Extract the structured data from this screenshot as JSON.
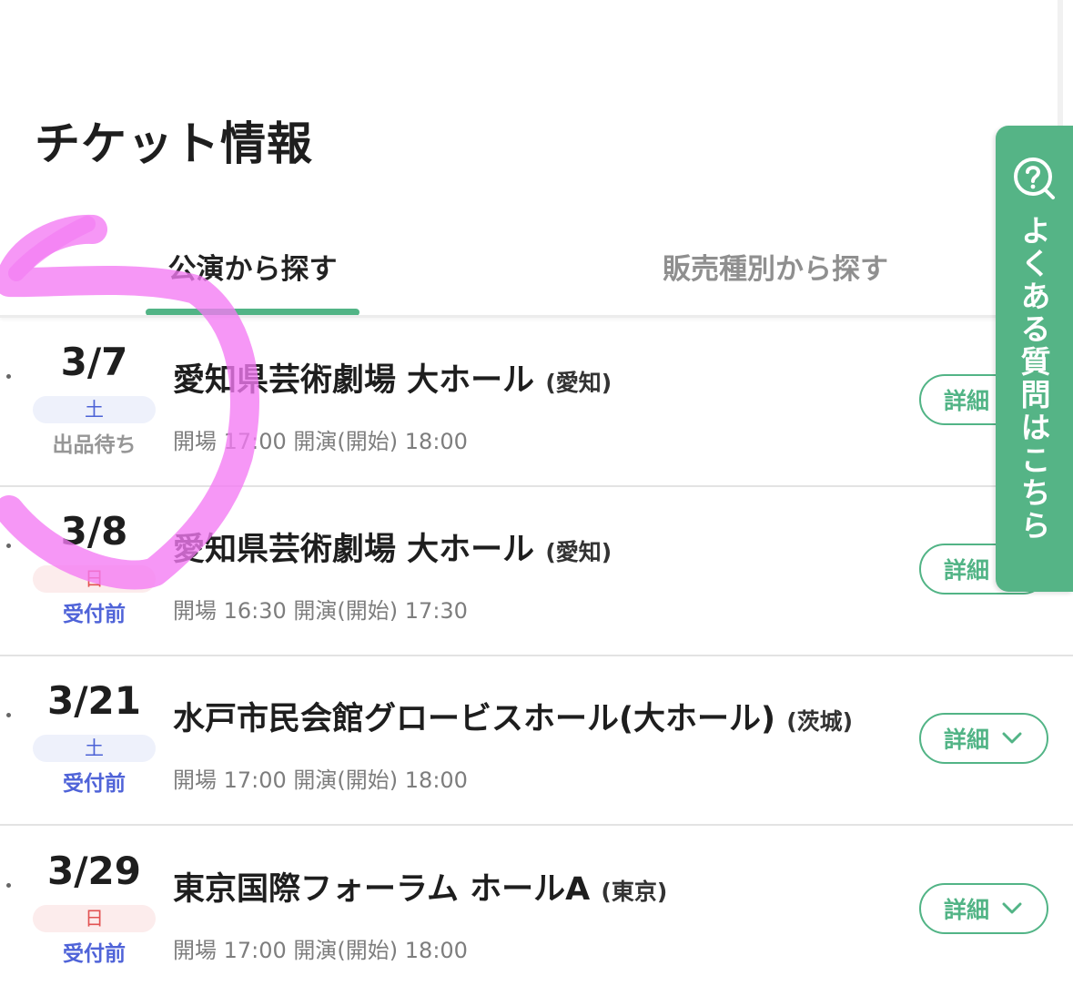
{
  "page": {
    "title": "チケット情報"
  },
  "tabs": [
    {
      "label": "公演から探す",
      "active": true
    },
    {
      "label": "販売種別から探す",
      "active": false
    }
  ],
  "events": [
    {
      "date": "3/7",
      "weekday": "土",
      "status": "出品待ち",
      "venue": "愛知県芸術劇場 大ホール",
      "prefecture": "(愛知)",
      "times": "開場 17:00 開演(開始) 18:00",
      "detail_label": "詳細"
    },
    {
      "date": "3/8",
      "weekday": "日",
      "status": "受付前",
      "venue": "愛知県芸術劇場 大ホール",
      "prefecture": "(愛知)",
      "times": "開場 16:30 開演(開始) 17:30",
      "detail_label": "詳細"
    },
    {
      "date": "3/21",
      "weekday": "土",
      "status": "受付前",
      "venue": "水戸市民会館グロービスホール(大ホール)",
      "prefecture": "(茨城)",
      "times": "開場 17:00 開演(開始) 18:00",
      "detail_label": "詳細"
    },
    {
      "date": "3/29",
      "weekday": "日",
      "status": "受付前",
      "venue": "東京国際フォーラム ホールA",
      "prefecture": "(東京)",
      "times": "開場 17:00 開演(開始) 18:00",
      "detail_label": "詳細"
    }
  ],
  "faq": {
    "label": "よくある質問はこちら",
    "icon": "question-circle-icon"
  },
  "colors": {
    "accent": "#52b486",
    "saturday": "#4c62d6",
    "sunday": "#e25252",
    "status_before": "#4f63d8",
    "status_wait": "#969696",
    "marker": "#f07cf0"
  }
}
